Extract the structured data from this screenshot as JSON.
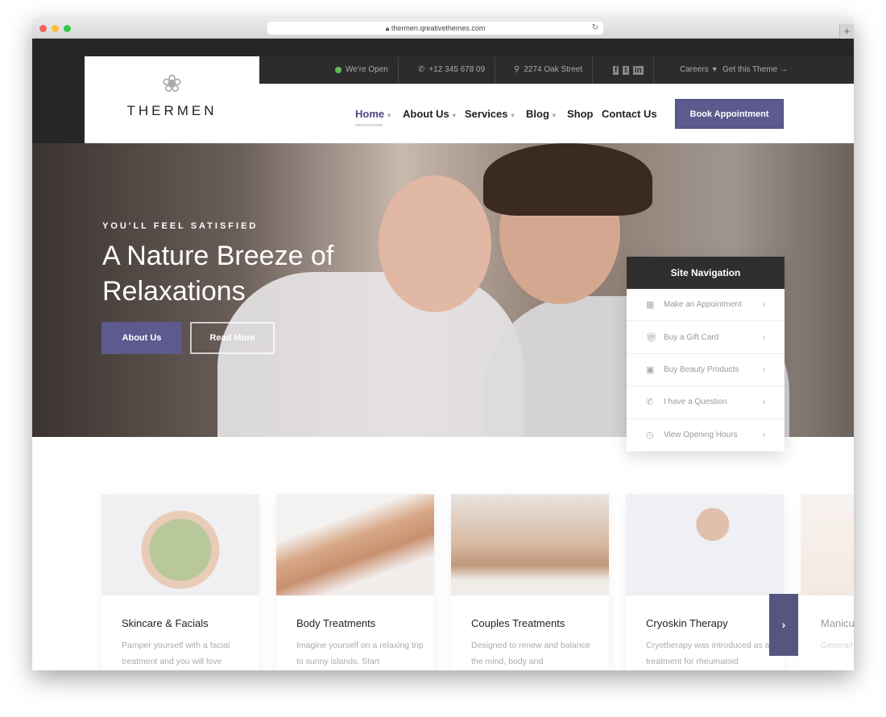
{
  "browser": {
    "url": "thermen.qreativethemes.com"
  },
  "topbar": {
    "open": "We're Open",
    "phone": "+12 345 678 09",
    "address": "2274 Oak Street",
    "careers": "Careers",
    "get_theme": "Get this Theme →"
  },
  "logo": {
    "name": "THERMEN"
  },
  "nav": {
    "items": [
      "Home",
      "About Us",
      "Services",
      "Blog",
      "Shop",
      "Contact Us"
    ],
    "book": "Book Appointment"
  },
  "hero": {
    "kicker": "YOU'LL FEEL SATISFIED",
    "title": "A Nature Breeze of Relaxations",
    "btn_about": "About Us",
    "btn_read": "Read More"
  },
  "site_nav": {
    "title": "Site Navigation",
    "items": [
      {
        "label": "Make an Appointment",
        "icon": "calendar-icon"
      },
      {
        "label": "Buy a Gift Card",
        "icon": "gift-icon"
      },
      {
        "label": "Buy Beauty Products",
        "icon": "shopping-bag-icon"
      },
      {
        "label": "I have a Question",
        "icon": "phone-icon"
      },
      {
        "label": "View Opening Hours",
        "icon": "clock-icon"
      }
    ]
  },
  "cards": [
    {
      "title": "Skincare & Facials",
      "desc": "Pamper yourself with a facial treatment and you will love"
    },
    {
      "title": "Body Treatments",
      "desc": "Imagine yourself on a relaxing trip to sunny islands. Start"
    },
    {
      "title": "Couples Treatments",
      "desc": "Designed to renew and balance the mind, body and"
    },
    {
      "title": "Cryoskin Therapy",
      "desc": "Cryotherapy was introduced as a treatment for rheumatoid"
    },
    {
      "title": "Manicu",
      "desc": "Generall Include"
    }
  ],
  "colors": {
    "accent": "#5c5a8e",
    "dark": "#2c2c2c"
  }
}
